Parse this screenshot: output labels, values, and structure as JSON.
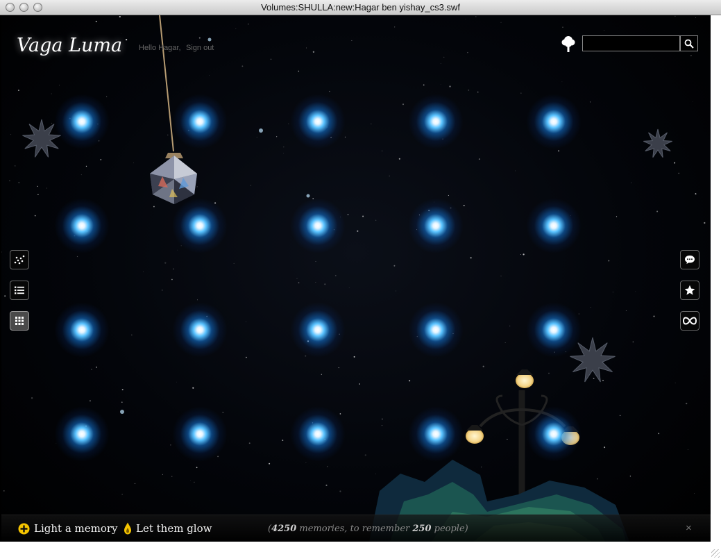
{
  "window": {
    "title": "Volumes:SHULLA:new:Hagar ben yishay_cs3.swf"
  },
  "header": {
    "brand": "Vaga Luma",
    "greeting": "Hello Hagar,",
    "sign_out": "Sign out",
    "search": {
      "value": "",
      "placeholder": ""
    }
  },
  "left_toolbar": [
    {
      "name": "scatter-view",
      "icon": "scatter-dots-icon",
      "active": false
    },
    {
      "name": "list-view",
      "icon": "list-icon",
      "active": false
    },
    {
      "name": "grid-view",
      "icon": "grid-icon",
      "active": true
    }
  ],
  "right_toolbar": [
    {
      "name": "comments",
      "icon": "speech-bubble-icon"
    },
    {
      "name": "favorites",
      "icon": "star-icon"
    },
    {
      "name": "infinity",
      "icon": "infinity-icon"
    }
  ],
  "memory_grid": {
    "rows": 4,
    "columns": 5
  },
  "footer": {
    "light_memory": "Light a memory",
    "let_glow": "Let them glow",
    "count_open": "(",
    "memories_count": "4250",
    "memories_text": " memories, to remember ",
    "people_count": "250",
    "people_text": " people)",
    "close": "×"
  },
  "colors": {
    "light_core": "#ffffff",
    "light_glow": "#5ac3ff",
    "icon_yellow": "#f5c400"
  }
}
